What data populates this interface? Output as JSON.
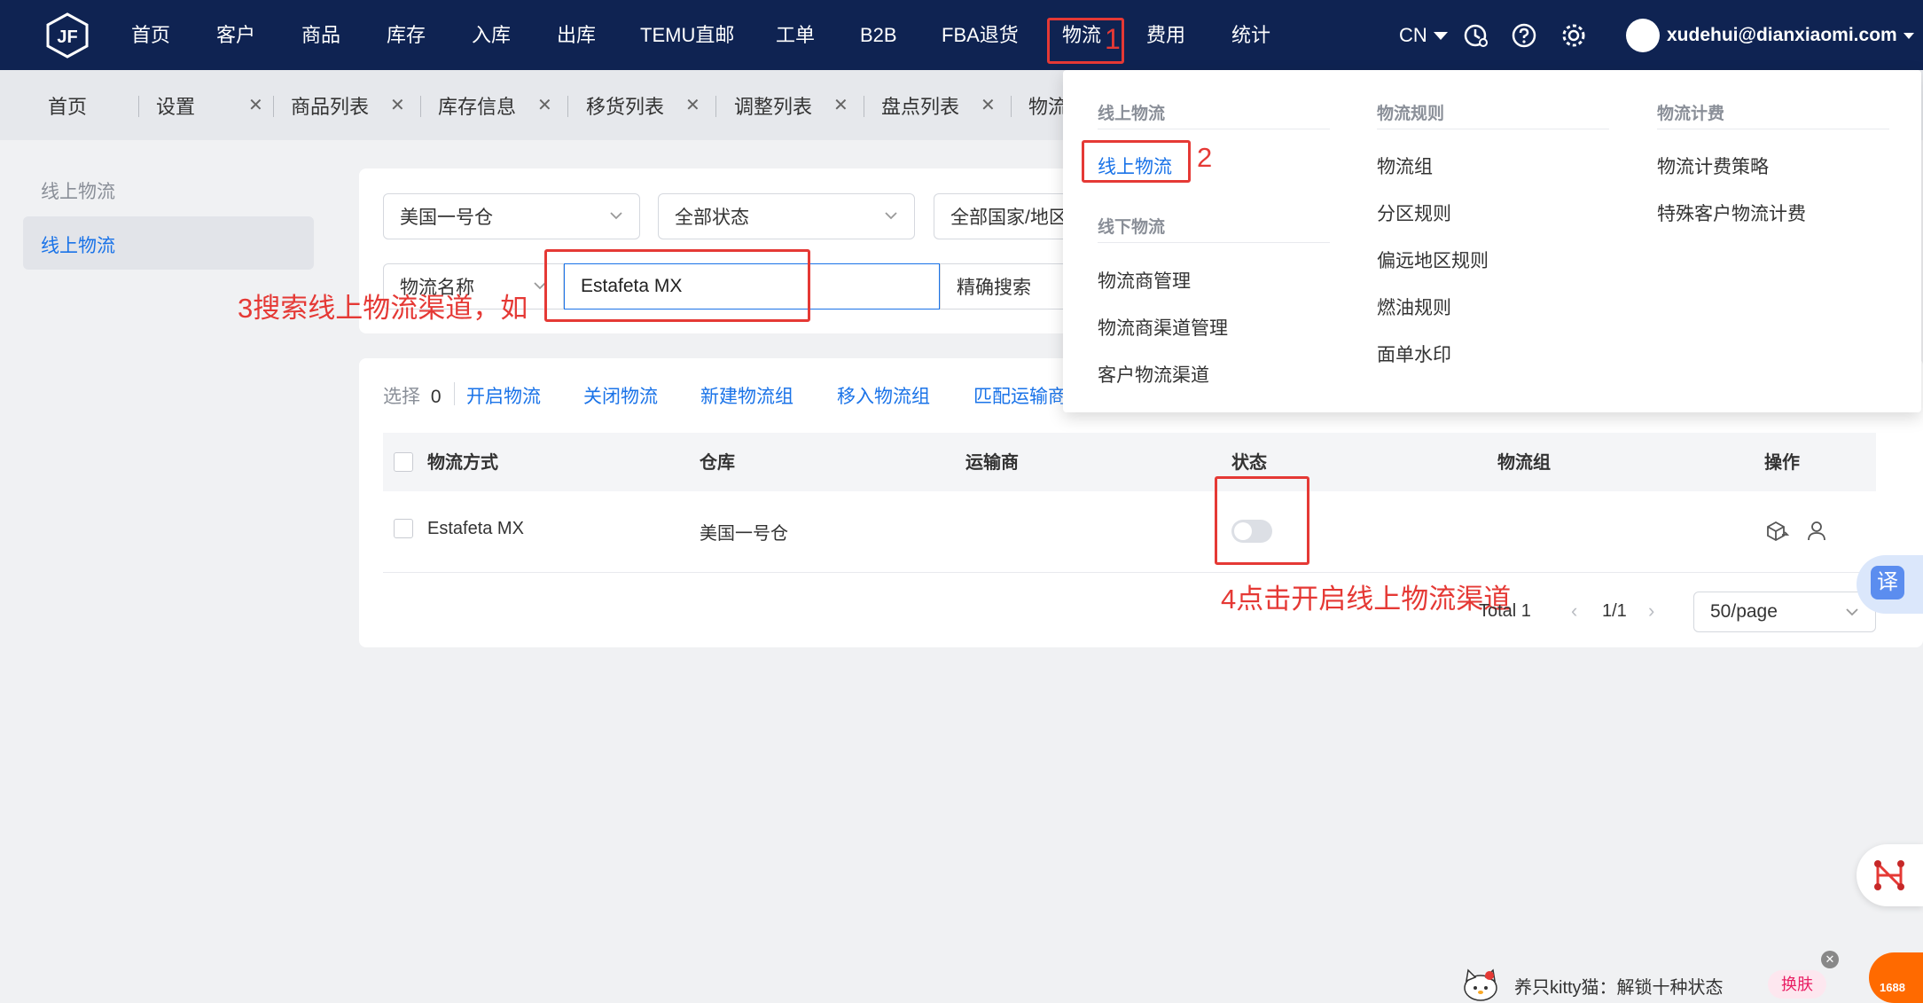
{
  "nav": {
    "items": [
      "首页",
      "客户",
      "商品",
      "库存",
      "入库",
      "出库",
      "TEMU直邮",
      "工单",
      "B2B",
      "FBA退货",
      "物流",
      "费用",
      "统计"
    ],
    "active": "物流",
    "lang": "CN",
    "user_email": "xudehui@dianxiaomi.com"
  },
  "tabs": [
    {
      "label": "首页"
    },
    {
      "label": "设置"
    },
    {
      "label": "商品列表"
    },
    {
      "label": "库存信息"
    },
    {
      "label": "移货列表"
    },
    {
      "label": "调整列表"
    },
    {
      "label": "盘点列表"
    },
    {
      "label": "物流"
    }
  ],
  "sidebar": {
    "group": "线上物流",
    "active_item": "线上物流"
  },
  "filters": {
    "warehouse": "美国一号仓",
    "status": "全部状态",
    "country": "全部国家/地区",
    "search_field": "物流名称",
    "search_value": "Estafeta MX",
    "search_mode": "精确搜索"
  },
  "toolbar": {
    "select_label": "选择",
    "select_count": "0",
    "actions": [
      "开启物流",
      "关闭物流",
      "新建物流组",
      "移入物流组",
      "匹配运输商"
    ]
  },
  "table": {
    "columns": [
      "物流方式",
      "仓库",
      "运输商",
      "状态",
      "物流组",
      "操作"
    ],
    "rows": [
      {
        "method": "Estafeta MX",
        "warehouse": "美国一号仓",
        "carrier": "",
        "status": "off",
        "group": ""
      }
    ]
  },
  "pagination": {
    "total": "Total 1",
    "page": "1/1",
    "page_size": "50/page"
  },
  "dropdown": {
    "col1_head1": "线上物流",
    "col1_item1": "线上物流",
    "col1_head2": "线下物流",
    "col1_items": [
      "物流商管理",
      "物流商渠道管理",
      "客户物流渠道"
    ],
    "col2_head": "物流规则",
    "col2_items": [
      "物流组",
      "分区规则",
      "偏远地区规则",
      "燃油规则",
      "面单水印"
    ],
    "col3_head": "物流计费",
    "col3_items": [
      "物流计费策略",
      "特殊客户物流计费"
    ]
  },
  "annotations": {
    "a1": "1",
    "a2": "2",
    "a3": "3搜索线上物流渠道，如",
    "a4": "4点击开启线上物流渠道"
  },
  "widgets": {
    "translate": "译",
    "promo_text": "养只kitty猫：解锁十种状态",
    "promo_button": "换肤",
    "promo_brand": "1688"
  },
  "colors": {
    "nav_bg": "#0f2352",
    "accent": "#1a73e8",
    "annotation": "#e53935"
  }
}
